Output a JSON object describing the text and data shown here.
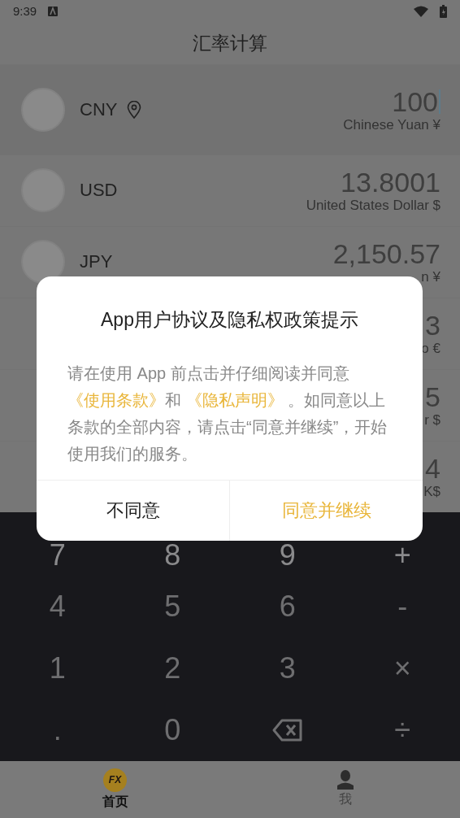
{
  "status_bar": {
    "time": "9:39"
  },
  "header": {
    "title": "汇率计算"
  },
  "currencies": [
    {
      "code": "CNY",
      "amount": "100",
      "name": "Chinese Yuan ¥",
      "selected": true,
      "located": true
    },
    {
      "code": "USD",
      "amount": "13.8001",
      "name": "United States Dollar $",
      "selected": false,
      "located": false
    },
    {
      "code": "JPY",
      "amount": "2,150.57",
      "name": "n ¥",
      "selected": false,
      "located": false
    },
    {
      "amount": "3",
      "name": "o €",
      "selected": false,
      "located": false
    },
    {
      "amount": "5",
      "name": "r $",
      "selected": false,
      "located": false
    },
    {
      "amount": "4",
      "name": "K$",
      "selected": false,
      "located": false
    }
  ],
  "keypad": [
    {
      "kind": "char",
      "label": "7"
    },
    {
      "kind": "char",
      "label": "8"
    },
    {
      "kind": "char",
      "label": "9"
    },
    {
      "kind": "char",
      "label": "+"
    },
    {
      "kind": "char",
      "label": "4"
    },
    {
      "kind": "char",
      "label": "5"
    },
    {
      "kind": "char",
      "label": "6"
    },
    {
      "kind": "char",
      "label": "-"
    },
    {
      "kind": "char",
      "label": "1"
    },
    {
      "kind": "char",
      "label": "2"
    },
    {
      "kind": "char",
      "label": "3"
    },
    {
      "kind": "char",
      "label": "×"
    },
    {
      "kind": "char",
      "label": "."
    },
    {
      "kind": "char",
      "label": "0"
    },
    {
      "kind": "backspace"
    },
    {
      "kind": "char",
      "label": "÷"
    }
  ],
  "tabs": [
    {
      "label": "首页",
      "selected": true,
      "kind": "logo",
      "badge": "FX"
    },
    {
      "label": "我",
      "selected": false,
      "kind": "person"
    }
  ],
  "dialog": {
    "title": "App用户协议及隐私权政策提示",
    "body": [
      {
        "kind": "text",
        "text": "请在使用 App 前点击并仔细阅读并同意 "
      },
      {
        "kind": "link",
        "text": "《使用条款》"
      },
      {
        "kind": "text",
        "text": "和 "
      },
      {
        "kind": "link",
        "text": "《隐私声明》"
      },
      {
        "kind": "text",
        "text": " 。如同意以上条款的全部内容，请点击“同意并继续”，开始使用我们的服务。"
      }
    ],
    "buttons": [
      {
        "label": "不同意",
        "kind": "secondary"
      },
      {
        "label": "同意并继续",
        "kind": "primary"
      }
    ]
  }
}
